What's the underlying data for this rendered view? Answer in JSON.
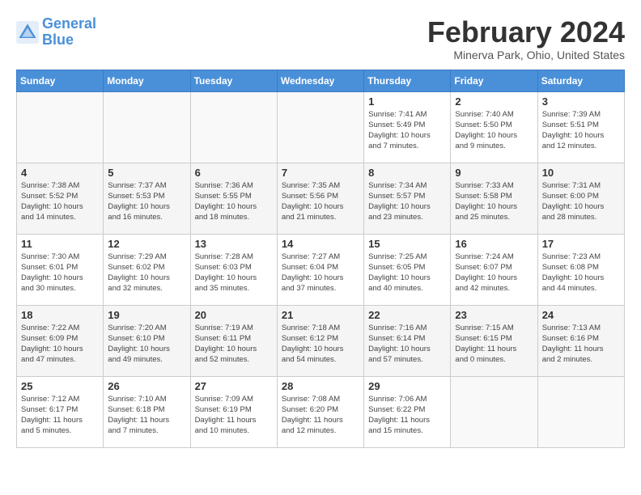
{
  "header": {
    "logo_line1": "General",
    "logo_line2": "Blue",
    "month_title": "February 2024",
    "location": "Minerva Park, Ohio, United States"
  },
  "days_of_week": [
    "Sunday",
    "Monday",
    "Tuesday",
    "Wednesday",
    "Thursday",
    "Friday",
    "Saturday"
  ],
  "weeks": [
    [
      {
        "num": "",
        "info": ""
      },
      {
        "num": "",
        "info": ""
      },
      {
        "num": "",
        "info": ""
      },
      {
        "num": "",
        "info": ""
      },
      {
        "num": "1",
        "info": "Sunrise: 7:41 AM\nSunset: 5:49 PM\nDaylight: 10 hours\nand 7 minutes."
      },
      {
        "num": "2",
        "info": "Sunrise: 7:40 AM\nSunset: 5:50 PM\nDaylight: 10 hours\nand 9 minutes."
      },
      {
        "num": "3",
        "info": "Sunrise: 7:39 AM\nSunset: 5:51 PM\nDaylight: 10 hours\nand 12 minutes."
      }
    ],
    [
      {
        "num": "4",
        "info": "Sunrise: 7:38 AM\nSunset: 5:52 PM\nDaylight: 10 hours\nand 14 minutes."
      },
      {
        "num": "5",
        "info": "Sunrise: 7:37 AM\nSunset: 5:53 PM\nDaylight: 10 hours\nand 16 minutes."
      },
      {
        "num": "6",
        "info": "Sunrise: 7:36 AM\nSunset: 5:55 PM\nDaylight: 10 hours\nand 18 minutes."
      },
      {
        "num": "7",
        "info": "Sunrise: 7:35 AM\nSunset: 5:56 PM\nDaylight: 10 hours\nand 21 minutes."
      },
      {
        "num": "8",
        "info": "Sunrise: 7:34 AM\nSunset: 5:57 PM\nDaylight: 10 hours\nand 23 minutes."
      },
      {
        "num": "9",
        "info": "Sunrise: 7:33 AM\nSunset: 5:58 PM\nDaylight: 10 hours\nand 25 minutes."
      },
      {
        "num": "10",
        "info": "Sunrise: 7:31 AM\nSunset: 6:00 PM\nDaylight: 10 hours\nand 28 minutes."
      }
    ],
    [
      {
        "num": "11",
        "info": "Sunrise: 7:30 AM\nSunset: 6:01 PM\nDaylight: 10 hours\nand 30 minutes."
      },
      {
        "num": "12",
        "info": "Sunrise: 7:29 AM\nSunset: 6:02 PM\nDaylight: 10 hours\nand 32 minutes."
      },
      {
        "num": "13",
        "info": "Sunrise: 7:28 AM\nSunset: 6:03 PM\nDaylight: 10 hours\nand 35 minutes."
      },
      {
        "num": "14",
        "info": "Sunrise: 7:27 AM\nSunset: 6:04 PM\nDaylight: 10 hours\nand 37 minutes."
      },
      {
        "num": "15",
        "info": "Sunrise: 7:25 AM\nSunset: 6:05 PM\nDaylight: 10 hours\nand 40 minutes."
      },
      {
        "num": "16",
        "info": "Sunrise: 7:24 AM\nSunset: 6:07 PM\nDaylight: 10 hours\nand 42 minutes."
      },
      {
        "num": "17",
        "info": "Sunrise: 7:23 AM\nSunset: 6:08 PM\nDaylight: 10 hours\nand 44 minutes."
      }
    ],
    [
      {
        "num": "18",
        "info": "Sunrise: 7:22 AM\nSunset: 6:09 PM\nDaylight: 10 hours\nand 47 minutes."
      },
      {
        "num": "19",
        "info": "Sunrise: 7:20 AM\nSunset: 6:10 PM\nDaylight: 10 hours\nand 49 minutes."
      },
      {
        "num": "20",
        "info": "Sunrise: 7:19 AM\nSunset: 6:11 PM\nDaylight: 10 hours\nand 52 minutes."
      },
      {
        "num": "21",
        "info": "Sunrise: 7:18 AM\nSunset: 6:12 PM\nDaylight: 10 hours\nand 54 minutes."
      },
      {
        "num": "22",
        "info": "Sunrise: 7:16 AM\nSunset: 6:14 PM\nDaylight: 10 hours\nand 57 minutes."
      },
      {
        "num": "23",
        "info": "Sunrise: 7:15 AM\nSunset: 6:15 PM\nDaylight: 11 hours\nand 0 minutes."
      },
      {
        "num": "24",
        "info": "Sunrise: 7:13 AM\nSunset: 6:16 PM\nDaylight: 11 hours\nand 2 minutes."
      }
    ],
    [
      {
        "num": "25",
        "info": "Sunrise: 7:12 AM\nSunset: 6:17 PM\nDaylight: 11 hours\nand 5 minutes."
      },
      {
        "num": "26",
        "info": "Sunrise: 7:10 AM\nSunset: 6:18 PM\nDaylight: 11 hours\nand 7 minutes."
      },
      {
        "num": "27",
        "info": "Sunrise: 7:09 AM\nSunset: 6:19 PM\nDaylight: 11 hours\nand 10 minutes."
      },
      {
        "num": "28",
        "info": "Sunrise: 7:08 AM\nSunset: 6:20 PM\nDaylight: 11 hours\nand 12 minutes."
      },
      {
        "num": "29",
        "info": "Sunrise: 7:06 AM\nSunset: 6:22 PM\nDaylight: 11 hours\nand 15 minutes."
      },
      {
        "num": "",
        "info": ""
      },
      {
        "num": "",
        "info": ""
      }
    ]
  ]
}
